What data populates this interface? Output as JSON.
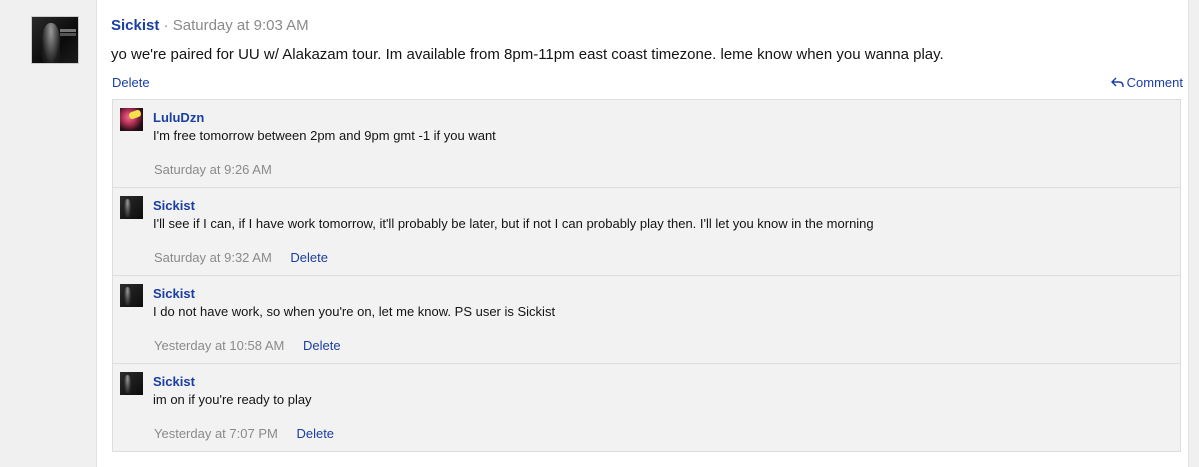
{
  "post": {
    "author": "Sickist",
    "separator": "·",
    "time": "Saturday at 9:03 AM",
    "body": "yo we're paired for UU w/ Alakazam tour. Im available from 8pm-11pm east coast timezone. leme know when you wanna play.",
    "delete_label": "Delete",
    "comment_label": "Comment"
  },
  "comments": [
    {
      "author": "LuluDzn",
      "text": "I'm free tomorrow between 2pm and 9pm gmt -1 if you want",
      "time": "Saturday at 9:26 AM",
      "delete_label": ""
    },
    {
      "author": "Sickist",
      "text": "I'll see if I can, if I have work tomorrow, it'll probably be later, but if not I can probably play then. I'll let you know in the morning",
      "time": "Saturday at 9:32 AM",
      "delete_label": "Delete"
    },
    {
      "author": "Sickist",
      "text": "I do not have work, so when you're on, let me know. PS user is Sickist",
      "time": "Yesterday at 10:58 AM",
      "delete_label": "Delete"
    },
    {
      "author": "Sickist",
      "text": "im on if you're ready to play",
      "time": "Yesterday at 7:07 PM",
      "delete_label": "Delete"
    }
  ],
  "colors": {
    "link": "#1a3fa3",
    "meta": "#8a8a8a",
    "background": "#f0f0f0"
  }
}
